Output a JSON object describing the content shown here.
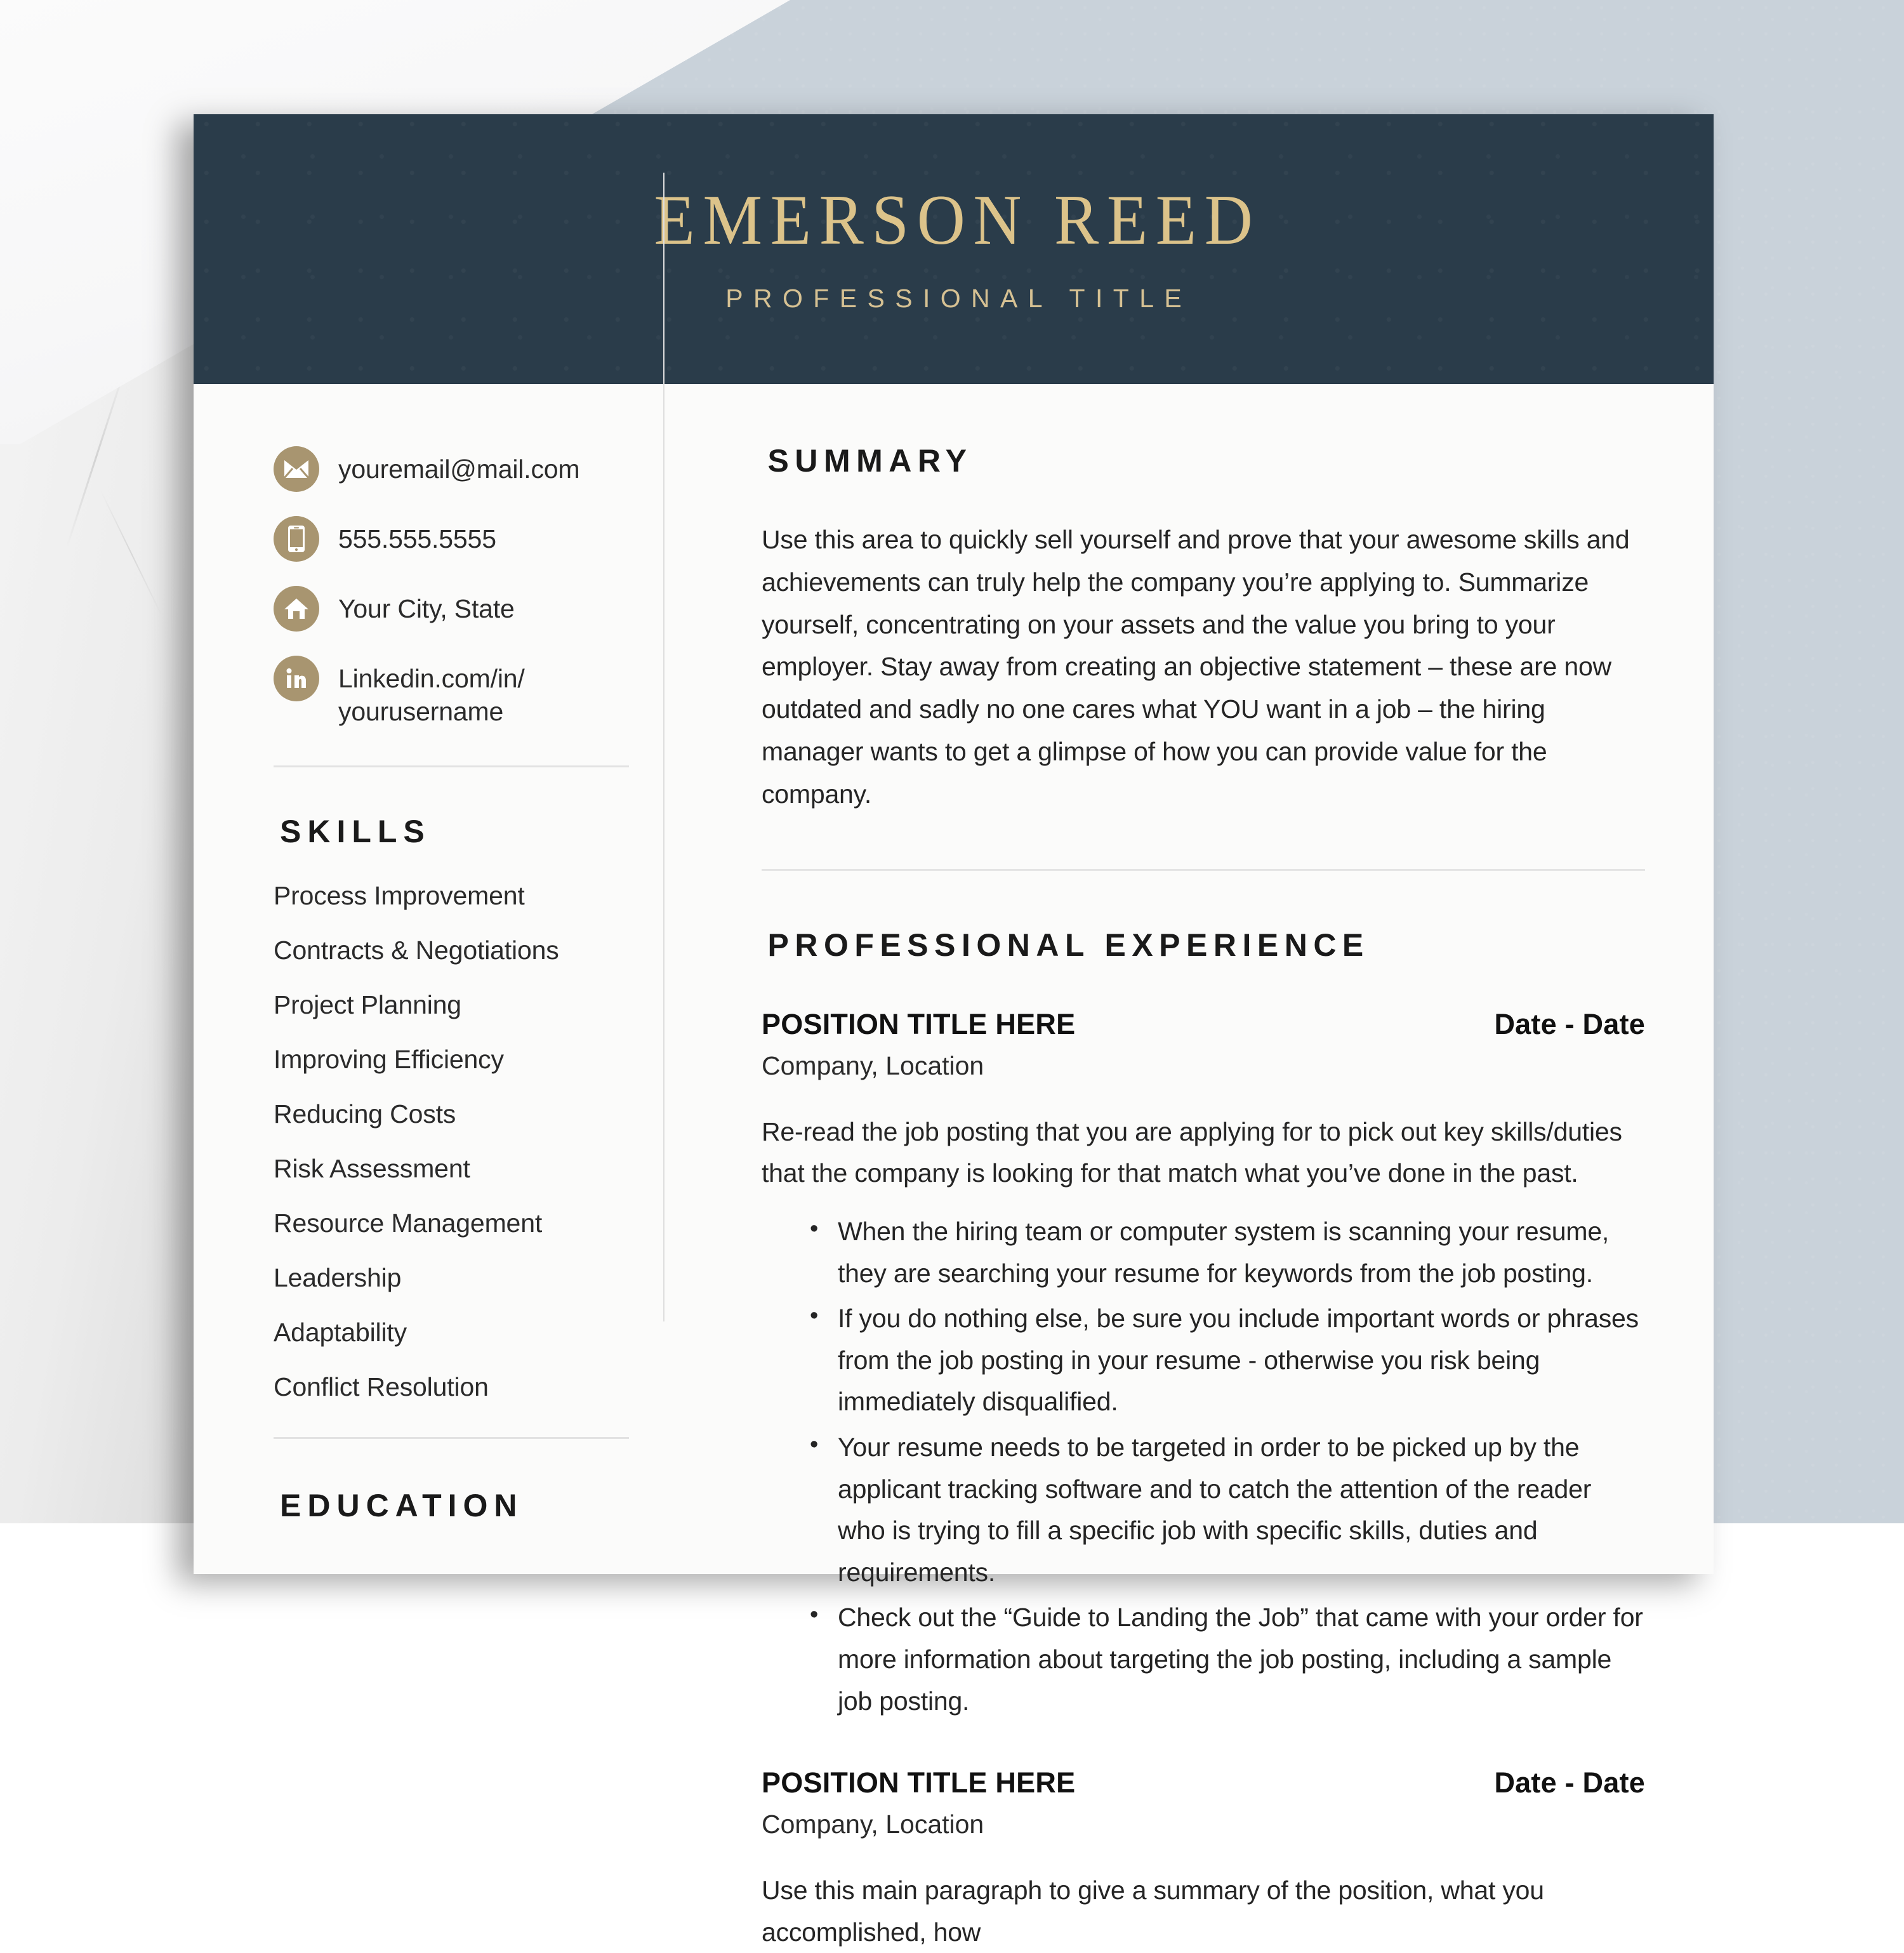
{
  "theme": {
    "header_navy": "#2a3c4a",
    "gold_text": "#dcc38a",
    "icon_gold": "#a89570",
    "page_bg": "#fbfbfa",
    "backdrop_blue_grey": "#c9d2da",
    "rule_grey": "#dedede"
  },
  "header": {
    "name": "EMERSON REED",
    "title": "PROFESSIONAL TITLE"
  },
  "sidebar": {
    "contact": [
      {
        "icon": "envelope-icon",
        "text": "youremail@mail.com"
      },
      {
        "icon": "mobile-phone-icon",
        "text": "555.555.5555"
      },
      {
        "icon": "home-icon",
        "text": "Your City, State"
      },
      {
        "icon": "linkedin-icon",
        "text": "Linkedin.com/in/ yourusername"
      }
    ],
    "skills_heading": "SKILLS",
    "skills": [
      "Process Improvement",
      "Contracts & Negotiations",
      "Project Planning",
      "Improving Efficiency",
      "Reducing Costs",
      "Risk Assessment",
      "Resource Management",
      "Leadership",
      "Adaptability",
      "Conflict Resolution"
    ],
    "education_heading": "EDUCATION"
  },
  "main": {
    "summary_heading": "SUMMARY",
    "summary_text": "Use this area to quickly sell yourself and prove that your awesome skills and achievements can truly help the company you’re applying to.  Summarize yourself, concentrating on your assets and the value you bring to your employer. Stay away from creating an objective statement – these are now outdated and sadly no one cares what YOU want in a job – the hiring manager wants to get a glimpse of how you can provide value for the company.",
    "experience_heading": "PROFESSIONAL EXPERIENCE",
    "jobs": [
      {
        "title": "POSITION TITLE HERE",
        "date": "Date - Date",
        "company": "Company, Location",
        "intro": "Re-read the job posting that you are applying for to pick out key skills/duties that the company is looking for that match what you’ve done in the past.",
        "bullets": [
          "When the hiring team or computer system is scanning your resume, they are searching your resume for keywords from the job posting.",
          "If you do nothing else, be sure you include important words or phrases from the job posting in your resume - otherwise you risk being immediately disqualified.",
          "Your resume needs to be targeted in order to be picked up by the applicant tracking software and to catch the attention of the reader who is trying to fill a specific job with specific skills, duties and requirements.",
          "Check out the “Guide to Landing the Job” that came with your order for more information about targeting the job posting, including a sample job posting."
        ]
      },
      {
        "title": "POSITION TITLE HERE",
        "date": "Date - Date",
        "company": "Company, Location",
        "intro": "Use this main paragraph to give a summary of the position, what you accomplished, how",
        "bullets": []
      }
    ]
  }
}
